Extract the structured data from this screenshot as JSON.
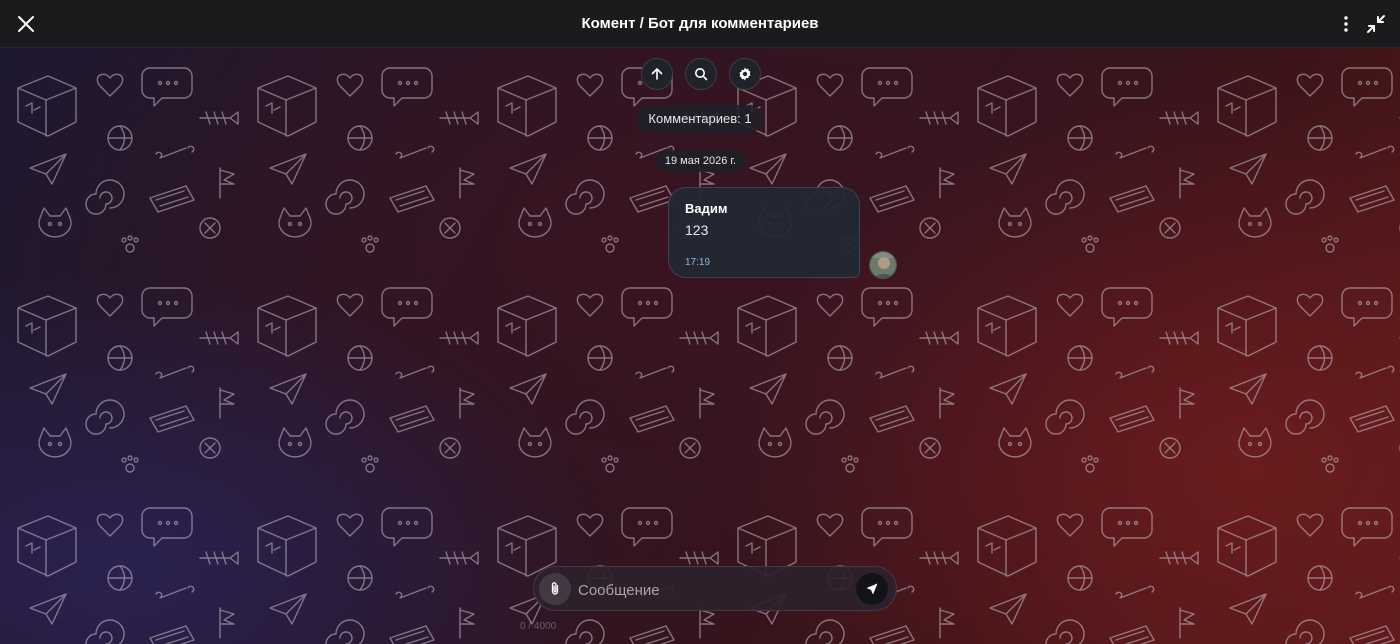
{
  "header": {
    "title": "Комент / Бот для комментариев",
    "close_icon": "close-icon",
    "more_icon": "more-vertical-icon",
    "minimize_icon": "minimize-icon"
  },
  "toolbar": {
    "scroll_up_icon": "arrow-up-icon",
    "search_icon": "search-icon",
    "settings_icon": "gear-icon"
  },
  "chat": {
    "comments_count_label": "Комментариев: 1",
    "date_label": "19 мая 2026 г.",
    "messages": [
      {
        "author": "Вадим",
        "text": "123",
        "time": "17:19"
      }
    ]
  },
  "composer": {
    "placeholder": "Сообщение",
    "char_counter": "0 / 4000",
    "attach_icon": "paperclip-icon",
    "send_icon": "send-icon"
  },
  "colors": {
    "header_bg": "#1b1b1d",
    "bubble_bg": "#222834",
    "time_color": "#8fb6e0",
    "background_accent_left": "#2a2150",
    "background_accent_right": "#6a1c1e"
  }
}
